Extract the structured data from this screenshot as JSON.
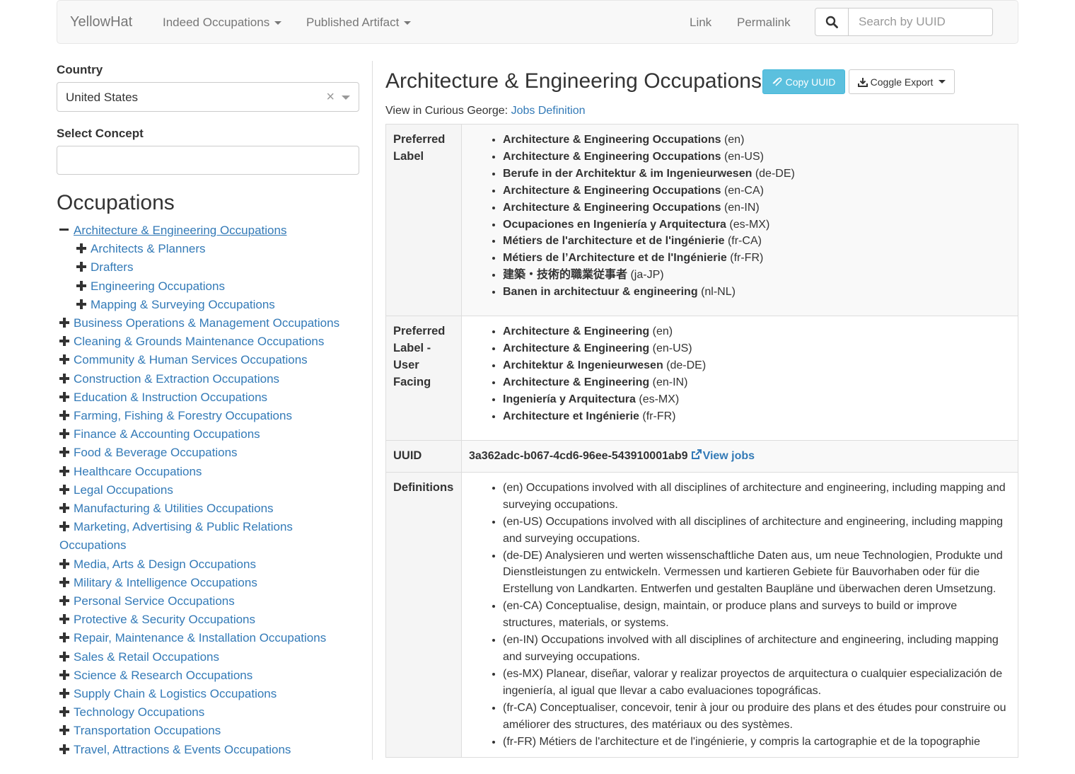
{
  "navbar": {
    "brand": "YellowHat",
    "menus": [
      "Indeed Occupations",
      "Published Artifact"
    ],
    "links": [
      "Link",
      "Permalink"
    ],
    "search_placeholder": "Search by UUID"
  },
  "sidebar": {
    "country_label": "Country",
    "country_value": "United States",
    "concept_label": "Select Concept",
    "concept_value": "",
    "heading": "Occupations",
    "tree": [
      {
        "label": "Architecture & Engineering Occupations",
        "level": 1,
        "expanded": true,
        "current": true
      },
      {
        "label": "Architects & Planners",
        "level": 2
      },
      {
        "label": "Drafters",
        "level": 2
      },
      {
        "label": "Engineering Occupations",
        "level": 2
      },
      {
        "label": "Mapping & Surveying Occupations",
        "level": 2
      },
      {
        "label": "Business Operations & Management Occupations",
        "level": 1
      },
      {
        "label": "Cleaning & Grounds Maintenance Occupations",
        "level": 1
      },
      {
        "label": "Community & Human Services Occupations",
        "level": 1
      },
      {
        "label": "Construction & Extraction Occupations",
        "level": 1
      },
      {
        "label": "Education & Instruction Occupations",
        "level": 1
      },
      {
        "label": "Farming, Fishing & Forestry Occupations",
        "level": 1
      },
      {
        "label": "Finance & Accounting Occupations",
        "level": 1
      },
      {
        "label": "Food & Beverage Occupations",
        "level": 1
      },
      {
        "label": "Healthcare Occupations",
        "level": 1
      },
      {
        "label": "Legal Occupations",
        "level": 1
      },
      {
        "label": "Manufacturing & Utilities Occupations",
        "level": 1
      },
      {
        "label": "Marketing, Advertising & Public Relations Occupations",
        "level": 1
      },
      {
        "label": "Media, Arts & Design Occupations",
        "level": 1
      },
      {
        "label": "Military & Intelligence Occupations",
        "level": 1
      },
      {
        "label": "Personal Service Occupations",
        "level": 1
      },
      {
        "label": "Protective & Security Occupations",
        "level": 1
      },
      {
        "label": "Repair, Maintenance & Installation Occupations",
        "level": 1
      },
      {
        "label": "Sales & Retail Occupations",
        "level": 1
      },
      {
        "label": "Science & Research Occupations",
        "level": 1
      },
      {
        "label": "Supply Chain & Logistics Occupations",
        "level": 1
      },
      {
        "label": "Technology Occupations",
        "level": 1
      },
      {
        "label": "Transportation Occupations",
        "level": 1
      },
      {
        "label": "Travel, Attractions & Events Occupations",
        "level": 1
      }
    ]
  },
  "main": {
    "title": "Architecture & Engineering Occupations",
    "copy_uuid_label": "Copy UUID",
    "export_label": "Coggle Export",
    "view_in_text": "View in Curious George: ",
    "view_link": "Jobs Definition",
    "preferred_label_header": "Preferred Label",
    "preferred_labels": [
      {
        "text": "Architecture & Engineering Occupations",
        "locale": "(en)"
      },
      {
        "text": "Architecture & Engineering Occupations",
        "locale": "(en-US)"
      },
      {
        "text": "Berufe in der Architektur & im Ingenieurwesen",
        "locale": "(de-DE)"
      },
      {
        "text": "Architecture & Engineering Occupations",
        "locale": "(en-CA)"
      },
      {
        "text": "Architecture & Engineering Occupations",
        "locale": "(en-IN)"
      },
      {
        "text": "Ocupaciones en Ingeniería y Arquitectura",
        "locale": "(es-MX)"
      },
      {
        "text": "Métiers de l'architecture et de l'ingénierie",
        "locale": "(fr-CA)"
      },
      {
        "text": "Métiers de l’Architecture et de l'Ingénierie",
        "locale": "(fr-FR)"
      },
      {
        "text": "建築・技術的職業従事者",
        "locale": "(ja-JP)"
      },
      {
        "text": "Banen in architectuur & engineering",
        "locale": "(nl-NL)"
      }
    ],
    "user_facing_header": "Preferred Label - User Facing",
    "user_facing_labels": [
      {
        "text": "Architecture & Engineering",
        "locale": "(en)"
      },
      {
        "text": "Architecture & Engineering",
        "locale": "(en-US)"
      },
      {
        "text": "Architektur & Ingenieurwesen",
        "locale": "(de-DE)"
      },
      {
        "text": "Architecture & Engineering",
        "locale": "(en-IN)"
      },
      {
        "text": "Ingeniería y Arquitectura",
        "locale": "(es-MX)"
      },
      {
        "text": "Architecture et Ingénierie",
        "locale": "(fr-FR)"
      }
    ],
    "uuid_header": "UUID",
    "uuid": "3a362adc-b067-4cd6-96ee-543910001ab9",
    "view_jobs_label": "View jobs",
    "definitions_header": "Definitions",
    "definitions": [
      "(en) Occupations involved with all disciplines of architecture and engineering, including mapping and surveying occupations.",
      "(en-US) Occupations involved with all disciplines of architecture and engineering, including mapping and surveying occupations.",
      "(de-DE) Analysieren und werten wissenschaftliche Daten aus, um neue Technologien, Produkte und Dienstleistungen zu entwickeln. Vermessen und kartieren Gebiete für Bauvorhaben oder für die Erstellung von Landkarten. Entwerfen und gestalten Baupläne und überwachen deren Umsetzung.",
      "(en-CA) Conceptualise, design, maintain, or produce plans and surveys to build or improve structures, materials, or systems.",
      "(en-IN) Occupations involved with all disciplines of architecture and engineering, including mapping and surveying occupations.",
      "(es-MX) Planear, diseñar, valorar y realizar proyectos de arquitectura o cualquier especialización de ingeniería, al igual que llevar a cabo evaluaciones topográficas.",
      "(fr-CA) Conceptualiser, concevoir, tenir à jour ou produire des plans et des études pour construire ou améliorer des structures, des matériaux ou des systèmes.",
      "(fr-FR) Métiers de l'architecture et de l'ingénierie, y compris la cartographie et de la topographie"
    ]
  }
}
